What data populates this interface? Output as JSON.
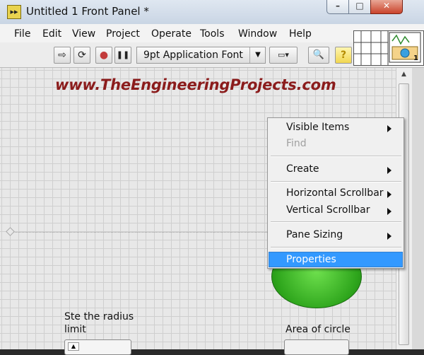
{
  "window": {
    "title": "Untitled 1 Front Panel *",
    "app_icon_glyph": "▸▸",
    "minimize_glyph": "–",
    "maximize_glyph": "□",
    "close_glyph": "✕"
  },
  "menubar": {
    "items": [
      "File",
      "Edit",
      "View",
      "Project",
      "Operate",
      "Tools",
      "Window",
      "Help"
    ]
  },
  "toolbar": {
    "run_glyph": "⇨",
    "run_continuous_glyph": "⟳",
    "abort_glyph": "●",
    "pause_glyph": "❚❚",
    "font_label": "9pt Application Font",
    "font_arrow": "▼",
    "align_glyph": "▭▾",
    "search_glyph": "🔍",
    "help_glyph": "?"
  },
  "connector_pane": {
    "terminal_number": "1"
  },
  "panel": {
    "watermark": "www.TheEngineeringProjects.com",
    "radius_label": "Ste the radius limit",
    "area_label": "Area of circle",
    "led_color": "#3dbb2a",
    "grid_color": "#cfcfcf"
  },
  "context_menu": {
    "items": [
      {
        "label": "Visible Items",
        "submenu": true,
        "enabled": true
      },
      {
        "label": "Find",
        "submenu": false,
        "enabled": false
      },
      {
        "label": "Create",
        "submenu": true,
        "enabled": true
      },
      {
        "label": "Horizontal Scrollbar",
        "submenu": true,
        "enabled": true
      },
      {
        "label": "Vertical Scrollbar",
        "submenu": true,
        "enabled": true
      },
      {
        "label": "Pane Sizing",
        "submenu": true,
        "enabled": true
      },
      {
        "label": "Properties",
        "submenu": false,
        "enabled": true,
        "highlighted": true
      }
    ],
    "highlight_color": "#3399ff"
  }
}
